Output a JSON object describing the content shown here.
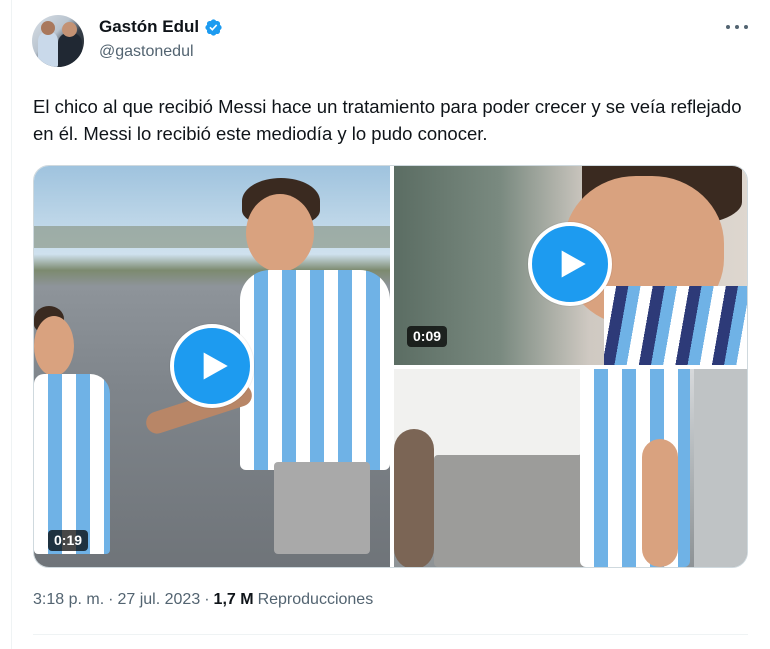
{
  "author": {
    "display_name": "Gastón Edul",
    "handle": "@gastonedul",
    "verified": true
  },
  "tweet": {
    "text": "El chico al que recibió Messi hace un tratamiento para poder crecer y se veía reflejado en él. Messi lo recibió este mediodía y lo pudo conocer."
  },
  "media": [
    {
      "kind": "video",
      "duration": "0:19"
    },
    {
      "kind": "video",
      "duration": "0:09"
    },
    {
      "kind": "image"
    }
  ],
  "meta": {
    "time": "3:18 p. m.",
    "separator": "·",
    "date": "27 jul. 2023",
    "views_count": "1,7 M",
    "views_label": "Reproducciones"
  },
  "colors": {
    "accent": "#1d9bf0",
    "text_primary": "#0f1419",
    "text_secondary": "#536471"
  },
  "icons": [
    "verified-badge-icon",
    "more-options-icon",
    "play-icon"
  ]
}
